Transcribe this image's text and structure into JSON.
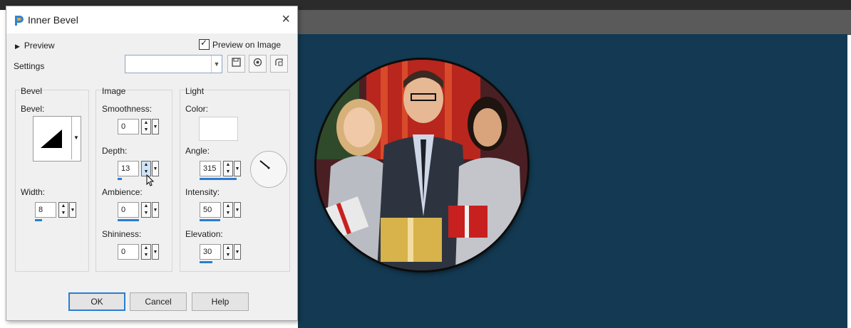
{
  "dialog": {
    "title": "Inner Bevel",
    "close_glyph": "×",
    "preview_label": "Preview",
    "preview_on_image_label": "Preview on Image",
    "preview_on_image_checked": true,
    "settings_label": "Settings",
    "settings_value": ""
  },
  "bevel": {
    "group_title": "Bevel",
    "bevel_label": "Bevel:",
    "width_label": "Width:",
    "width_value": "8"
  },
  "image": {
    "group_title": "Image",
    "smoothness_label": "Smoothness:",
    "smoothness_value": "0",
    "depth_label": "Depth:",
    "depth_value": "13",
    "ambience_label": "Ambience:",
    "ambience_value": "0",
    "shininess_label": "Shininess:",
    "shininess_value": "0"
  },
  "light": {
    "group_title": "Light",
    "color_label": "Color:",
    "color_value": "#ffffff",
    "angle_label": "Angle:",
    "angle_value": "315",
    "intensity_label": "Intensity:",
    "intensity_value": "50",
    "elevation_label": "Elevation:",
    "elevation_value": "30"
  },
  "buttons": {
    "ok": "OK",
    "cancel": "Cancel",
    "help": "Help"
  },
  "icons": {
    "app": "paintshop-icon",
    "save": "save-icon",
    "reset": "reset-icon",
    "manage": "manage-presets-icon"
  },
  "colors": {
    "canvas": "#133a52",
    "accent": "#2b7dd1"
  }
}
